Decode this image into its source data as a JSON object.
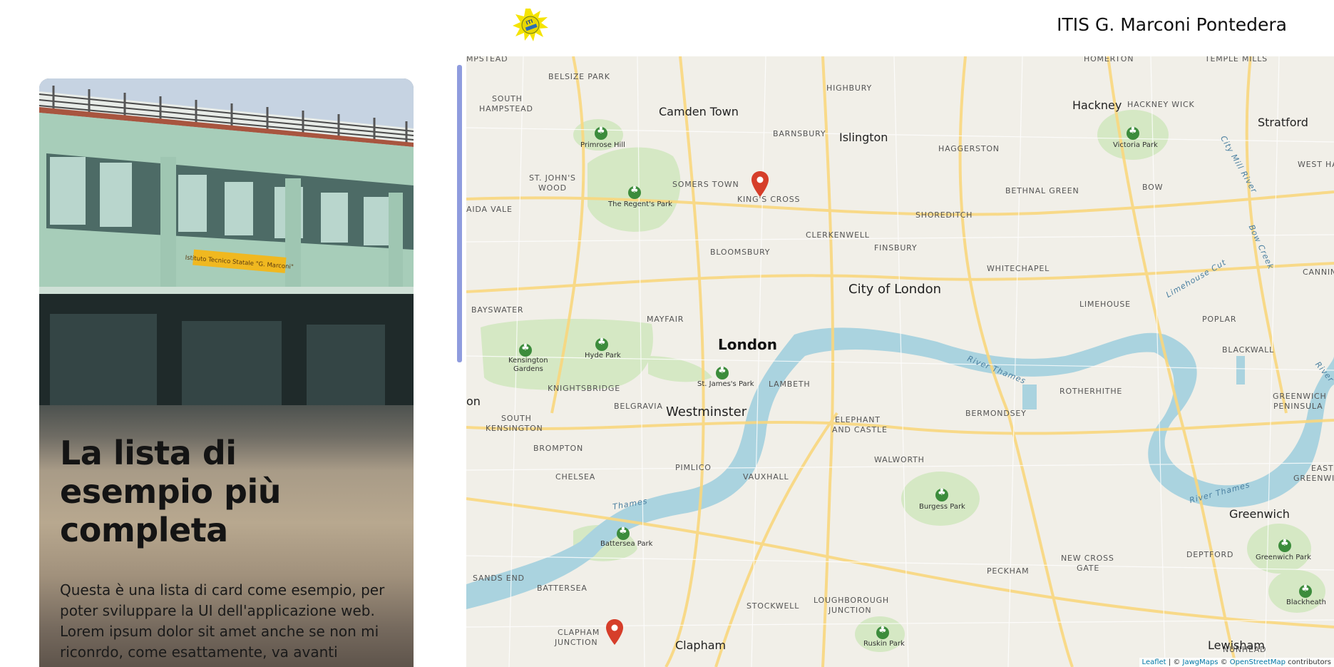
{
  "header": {
    "site_title": "ITIS G. Marconi Pontedera",
    "logo_icon": "marconi-logo-icon"
  },
  "card": {
    "title": "La lista di esempio più completa",
    "text": "Questa è una lista di card come esempio, per poter sviluppare la UI dell'applicazione web. Lorem ipsum dolor sit amet anche se non mi riconrdo, come esattamente, va avanti",
    "sign_text": "Istituto Tecnico Statale \"G. Marconi\""
  },
  "map": {
    "labels": {
      "mpstead": "MPSTEAD",
      "belsize_park": "BELSIZE PARK",
      "south_hampstead_1": "SOUTH",
      "south_hampstead_2": "HAMPSTEAD",
      "camden_town": "Camden Town",
      "primrose_hill": "Primrose Hill",
      "highbury": "HIGHBURY",
      "homerton": "HOMERTON",
      "temple_mills": "TEMPLE MILLS",
      "hackney": "Hackney",
      "hackney_wick": "HACKNEY WICK",
      "stratford": "Stratford",
      "barnsbury": "BARNSBURY",
      "islington": "Islington",
      "haggerston": "HAGGERSTON",
      "victoria_park": "Victoria Park",
      "west_ham": "WEST HAM",
      "st_johns_wood_1": "ST. JOHN'S",
      "st_johns_wood_2": "WOOD",
      "somers_town": "SOMERS TOWN",
      "kings_cross": "KING'S CROSS",
      "regents_park": "The Regent's Park",
      "bethnal_green": "BETHNAL GREEN",
      "bow": "BOW",
      "maida_vale": "AIDA VALE",
      "shoreditch": "SHOREDITCH",
      "clerkenwell": "CLERKENWELL",
      "bloomsbury": "BLOOMSBURY",
      "finsbury": "FINSBURY",
      "whitechapel": "WHITECHAPEL",
      "canning": "CANNING",
      "city_of_london": "City of London",
      "bayswater": "BAYSWATER",
      "mayfair": "MAYFAIR",
      "limehouse": "LIMEHOUSE",
      "poplar": "POPLAR",
      "london": "London",
      "hyde_park": "Hyde Park",
      "kensington_gardens_1": "Kensington",
      "kensington_gardens_2": "Gardens",
      "blackwall": "BLACKWALL",
      "st_james_park": "St. James's Park",
      "knightsbridge": "KNIGHTSBRIDGE",
      "lambeth": "LAMBETH",
      "rotherhithe": "ROTHERHITHE",
      "greenwich_peninsula_1": "GREENWICH",
      "greenwich_peninsula_2": "PENINSULA",
      "on": "on",
      "belgravia": "BELGRAVIA",
      "westminster": "Westminster",
      "bermondsey": "BERMONDSEY",
      "south_kensington_1": "SOUTH",
      "south_kensington_2": "KENSINGTON",
      "elephant_castle_1": "ELEPHANT",
      "elephant_castle_2": "AND CASTLE",
      "brompton": "BROMPTON",
      "walworth": "WALWORTH",
      "east_greenwich_1": "EAST",
      "east_greenwich_2": "GREENWI",
      "pimlico": "PIMLICO",
      "chelsea": "CHELSEA",
      "vauxhall": "VAUXHALL",
      "burgess_park": "Burgess Park",
      "river_thames_1": "River Thames",
      "river_thames_2": "River Thames",
      "thames": "Thames",
      "greenwich": "Greenwich",
      "battersea_park": "Battersea Park",
      "deptford": "DEPTFORD",
      "new_cross_gate_1": "NEW CROSS",
      "new_cross_gate_2": "GATE",
      "greenwich_park": "Greenwich Park",
      "sands_end": "SANDS END",
      "peckham": "PECKHAM",
      "battersea": "BATTERSEA",
      "blackheath": "Blackheath",
      "stockwell": "STOCKWELL",
      "loughborough_1": "LOUGHBOROUGH",
      "loughborough_2": "JUNCTION",
      "clapham_junction_1": "CLAPHAM",
      "clapham_junction_2": "JUNCTION",
      "ruskin_park": "Ruskin Park",
      "nunhead": "NUNHEAD",
      "lewisham": "Lewisham",
      "clapham": "Clapham",
      "limehouse_cut": "Limehouse Cut",
      "bow_creek": "Bow Creek",
      "city_mill_river": "City Mill River",
      "river_east": "River"
    },
    "attribution": {
      "leaflet": "Leaflet",
      "sep1": " | © ",
      "jawg": "JawgMaps",
      "sep2": " © ",
      "osm": "OpenStreetMap",
      "contributors": " contributors"
    }
  }
}
